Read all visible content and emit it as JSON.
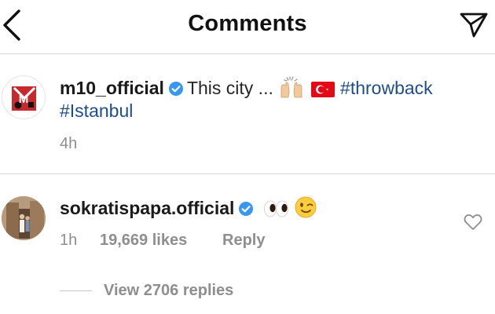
{
  "header": {
    "title": "Comments"
  },
  "post": {
    "username": "m10_official",
    "caption": "This city ...",
    "hashtag_1": "#throwback",
    "hashtag_2": "#Istanbul",
    "time": "4h",
    "avatar_letter": "M"
  },
  "comment": {
    "username": "sokratispapa.official",
    "time": "1h",
    "likes": "19,669 likes",
    "reply_label": "Reply",
    "view_replies": "View 2706 replies"
  },
  "colors": {
    "verified": "#3897f0",
    "hashtag": "#1d4e8a",
    "meta": "#8e8e8e",
    "avatar_red": "#c62a2f"
  },
  "icons": [
    "back-arrow-icon",
    "send-icon",
    "verified-badge-icon",
    "raising-hands-emoji-icon",
    "turkey-flag-emoji-icon",
    "eyes-emoji-icon",
    "winking-face-emoji-icon",
    "heart-outline-icon"
  ]
}
